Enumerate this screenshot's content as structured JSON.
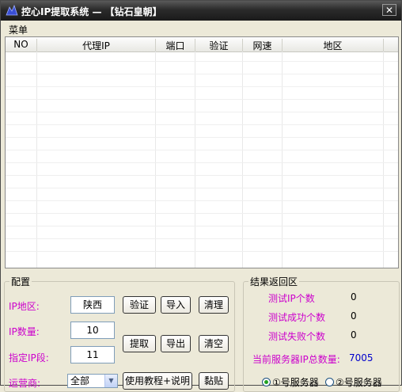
{
  "window": {
    "title": "控心IP提取系统 — 【钻石皇朝】",
    "close_glyph": "✕"
  },
  "menu": {
    "label": "菜单"
  },
  "table": {
    "columns": [
      "NO",
      "代理IP",
      "端口",
      "验证",
      "网速",
      "地区"
    ]
  },
  "config": {
    "title": "配置",
    "ip_region_label": "IP地区:",
    "ip_region_value": "陕西",
    "ip_count_label": "IP数量:",
    "ip_count_value": "10",
    "ip_segment_label": "指定IP段:",
    "ip_segment_value": "11",
    "isp_label": "运营商:",
    "isp_value": "全部",
    "buttons": {
      "verify": "验证",
      "import": "导入",
      "clear": "清理",
      "extract": "提取",
      "export": "导出",
      "empty": "清空",
      "tutorial": "使用教程+说明",
      "paste": "黏贴"
    }
  },
  "results": {
    "title": "结果返回区",
    "test_ip_count_label": "测试IP个数",
    "test_ip_count": "0",
    "success_count_label": "测试成功个数",
    "success_count": "0",
    "fail_count_label": "测试失败个数",
    "fail_count": "0",
    "server_total_label": "当前服务器IP总数量:",
    "server_total": "7005",
    "server1_label": "①号服务器",
    "server2_label": "②号服务器"
  },
  "colors": {
    "accent_label": "#cc00cc",
    "server_total_value": "#0000cc"
  }
}
